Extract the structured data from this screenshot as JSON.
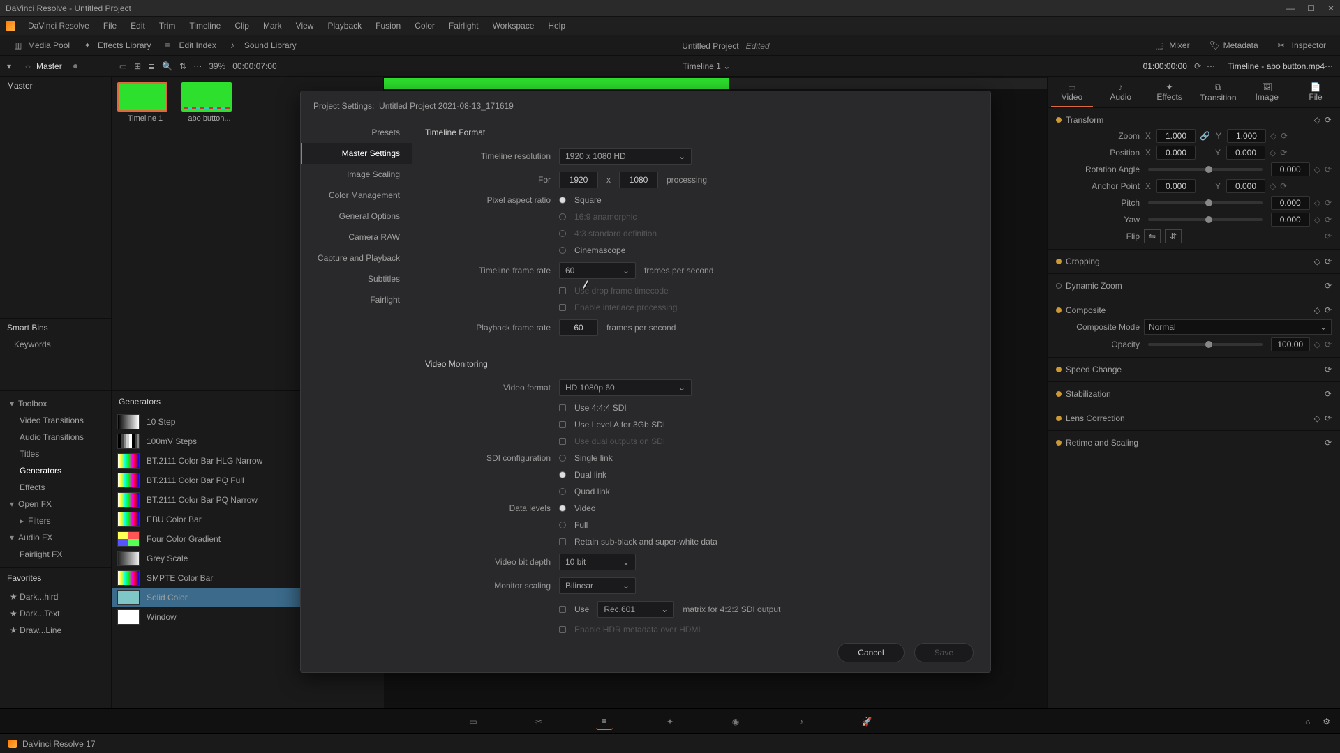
{
  "titlebar": {
    "title": "DaVinci Resolve - Untitled Project"
  },
  "menu": [
    "DaVinci Resolve",
    "File",
    "Edit",
    "Trim",
    "Timeline",
    "Clip",
    "Mark",
    "View",
    "Playback",
    "Fusion",
    "Color",
    "Fairlight",
    "Workspace",
    "Help"
  ],
  "toolbar": {
    "media_pool": "Media Pool",
    "effects": "Effects Library",
    "edit_index": "Edit Index",
    "sound_lib": "Sound Library",
    "project_title": "Untitled Project",
    "edited": "Edited",
    "mixer": "Mixer",
    "metadata": "Metadata",
    "inspector": "Inspector"
  },
  "subhdr": {
    "master": "Master",
    "zoom_pct": "39%",
    "tc1": "00:00:07:00",
    "timeline_name": "Timeline 1",
    "tc2": "01:00:00:00",
    "clip_name": "Timeline - abo button.mp4"
  },
  "left": {
    "master": "Master",
    "smart_bins": "Smart Bins",
    "keywords": "Keywords"
  },
  "thumbs": {
    "t1": "Timeline 1",
    "t2": "abo button..."
  },
  "toolbox": {
    "root": "Toolbox",
    "video_trans": "Video Transitions",
    "audio_trans": "Audio Transitions",
    "titles": "Titles",
    "generators": "Generators",
    "effects": "Effects",
    "openfx": "Open FX",
    "filters": "Filters",
    "audiofx": "Audio FX",
    "fairlightfx": "Fairlight FX",
    "favorites": "Favorites",
    "fav1": "Dark...hird",
    "fav2": "Dark...Text",
    "fav3": "Draw...Line"
  },
  "generators": {
    "header": "Generators",
    "items": [
      "10 Step",
      "100mV Steps",
      "BT.2111 Color Bar HLG Narrow",
      "BT.2111 Color Bar PQ Full",
      "BT.2111 Color Bar PQ Narrow",
      "EBU Color Bar",
      "Four Color Gradient",
      "Grey Scale",
      "SMPTE Color Bar",
      "Solid Color",
      "Window"
    ]
  },
  "inspector": {
    "tabs": [
      "Video",
      "Audio",
      "Effects",
      "Transition",
      "Image",
      "File"
    ],
    "transform": "Transform",
    "zoom": "Zoom",
    "zx": "1.000",
    "zy": "1.000",
    "position": "Position",
    "px": "0.000",
    "py": "0.000",
    "rot": "Rotation Angle",
    "rv": "0.000",
    "anchor": "Anchor Point",
    "ax": "0.000",
    "ay": "0.000",
    "pitch": "Pitch",
    "pv": "0.000",
    "yaw": "Yaw",
    "yv": "0.000",
    "flip": "Flip",
    "cropping": "Cropping",
    "dynzoom": "Dynamic Zoom",
    "composite": "Composite",
    "comp_mode_lbl": "Composite Mode",
    "comp_mode": "Normal",
    "opacity_lbl": "Opacity",
    "opacity": "100.00",
    "speed": "Speed Change",
    "stab": "Stabilization",
    "lens": "Lens Correction",
    "retime": "Retime and Scaling"
  },
  "modal": {
    "title_prefix": "Project Settings:",
    "title": "Untitled Project 2021-08-13_171619",
    "nav": [
      "Presets",
      "Master Settings",
      "Image Scaling",
      "Color Management",
      "General Options",
      "Camera RAW",
      "Capture and Playback",
      "Subtitles",
      "Fairlight"
    ],
    "sec_tf": "Timeline Format",
    "tl_res_lbl": "Timeline resolution",
    "tl_res": "1920 x 1080 HD",
    "for": "For",
    "w": "1920",
    "x": "x",
    "h": "1080",
    "processing": "processing",
    "par_lbl": "Pixel aspect ratio",
    "par_sq": "Square",
    "par_169": "16:9 anamorphic",
    "par_43": "4:3 standard definition",
    "par_cs": "Cinemascope",
    "tfr_lbl": "Timeline frame rate",
    "tfr": "60",
    "fps": "frames per second",
    "dft": "Use drop frame timecode",
    "intl": "Enable interlace processing",
    "pfr_lbl": "Playback frame rate",
    "pfr": "60",
    "sec_vm": "Video Monitoring",
    "vf_lbl": "Video format",
    "vf": "HD 1080p 60",
    "u444": "Use 4:4:4 SDI",
    "lvla": "Use Level A for 3Gb SDI",
    "dual": "Use dual outputs on SDI",
    "sdi_lbl": "SDI configuration",
    "sdi_single": "Single link",
    "sdi_dual": "Dual link",
    "sdi_quad": "Quad link",
    "dl_lbl": "Data levels",
    "dl_video": "Video",
    "dl_full": "Full",
    "retain": "Retain sub-black and super-white data",
    "vbd_lbl": "Video bit depth",
    "vbd": "10 bit",
    "ms_lbl": "Monitor scaling",
    "ms": "Bilinear",
    "use": "Use",
    "rec": "Rec.601",
    "matrix": "matrix for 4:2:2 SDI output",
    "hdr": "Enable HDR metadata over HDMI",
    "cancel": "Cancel",
    "save": "Save"
  },
  "status": {
    "label": "DaVinci Resolve 17"
  }
}
